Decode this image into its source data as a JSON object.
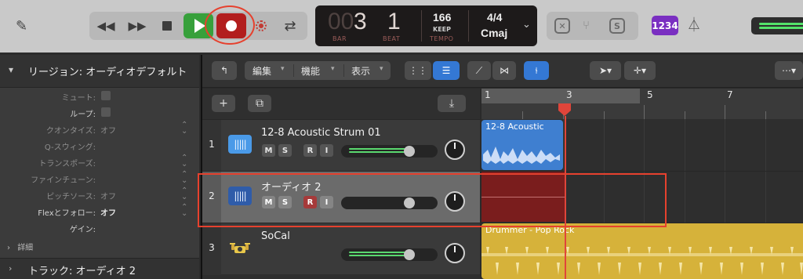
{
  "transport": {
    "lcd": {
      "bar_dim": "00",
      "bar": "3",
      "beat": "1",
      "bar_label": "BAR",
      "beat_label": "BEAT",
      "tempo": "166",
      "keep": "KEEP",
      "tempo_label": "TEMPO",
      "time_signature": "4/4",
      "key": "Cmaj"
    },
    "count_in_label": "1234",
    "colors": {
      "play": "#37a03b",
      "record": "#b21e1e",
      "highlight_ring": "#e6412e",
      "count_in": "#7a2fc1"
    }
  },
  "inspector": {
    "header_title": "リージョン: オーディオデフォルト",
    "params": [
      {
        "label": "ミュート:",
        "type": "checkbox",
        "active": false
      },
      {
        "label": "ループ:",
        "type": "checkbox",
        "active": true
      },
      {
        "label": "クオンタイズ:",
        "value": "オフ",
        "type": "select",
        "active": false
      },
      {
        "label": "Q-スウィング:",
        "value": "",
        "type": "text",
        "active": false
      },
      {
        "label": "トランスポーズ:",
        "value": "",
        "type": "select",
        "active": false
      },
      {
        "label": "ファインチューン:",
        "value": "",
        "type": "select",
        "active": false
      },
      {
        "label": "ピッチソース:",
        "value": "オフ",
        "type": "select",
        "active": false
      },
      {
        "label": "Flexとフォロー:",
        "value": "オフ",
        "type": "select",
        "active": true
      },
      {
        "label": "ゲイン:",
        "value": "",
        "type": "text",
        "active": true
      }
    ],
    "detail_label": "詳細",
    "track_section_title": "トラック: オーディオ 2"
  },
  "main_toolbar": {
    "menus": [
      "編集",
      "機能",
      "表示"
    ]
  },
  "ruler": {
    "markers": [
      "1",
      "3",
      "5",
      "7"
    ]
  },
  "tracks": [
    {
      "number": "1",
      "name": "12-8 Acoustic Strum 01",
      "mute": "M",
      "solo": "S",
      "rec": "R",
      "input": "I",
      "volume": 0.72,
      "selected": false,
      "armed": false
    },
    {
      "number": "2",
      "name": "オーディオ 2",
      "mute": "M",
      "solo": "S",
      "rec": "R",
      "input": "I",
      "volume": 0.72,
      "selected": true,
      "armed": true
    },
    {
      "number": "3",
      "name": "SoCal",
      "volume": 0.72,
      "selected": false,
      "armed": false
    }
  ],
  "regions": [
    {
      "track": 1,
      "name": "12-8 Acoustic",
      "color": "#3f7fd0"
    },
    {
      "track": 2,
      "name": "",
      "color": "#7a1d1d"
    },
    {
      "track": 3,
      "name": "Drummer - Pop Rock",
      "color": "#d6b23a"
    }
  ]
}
